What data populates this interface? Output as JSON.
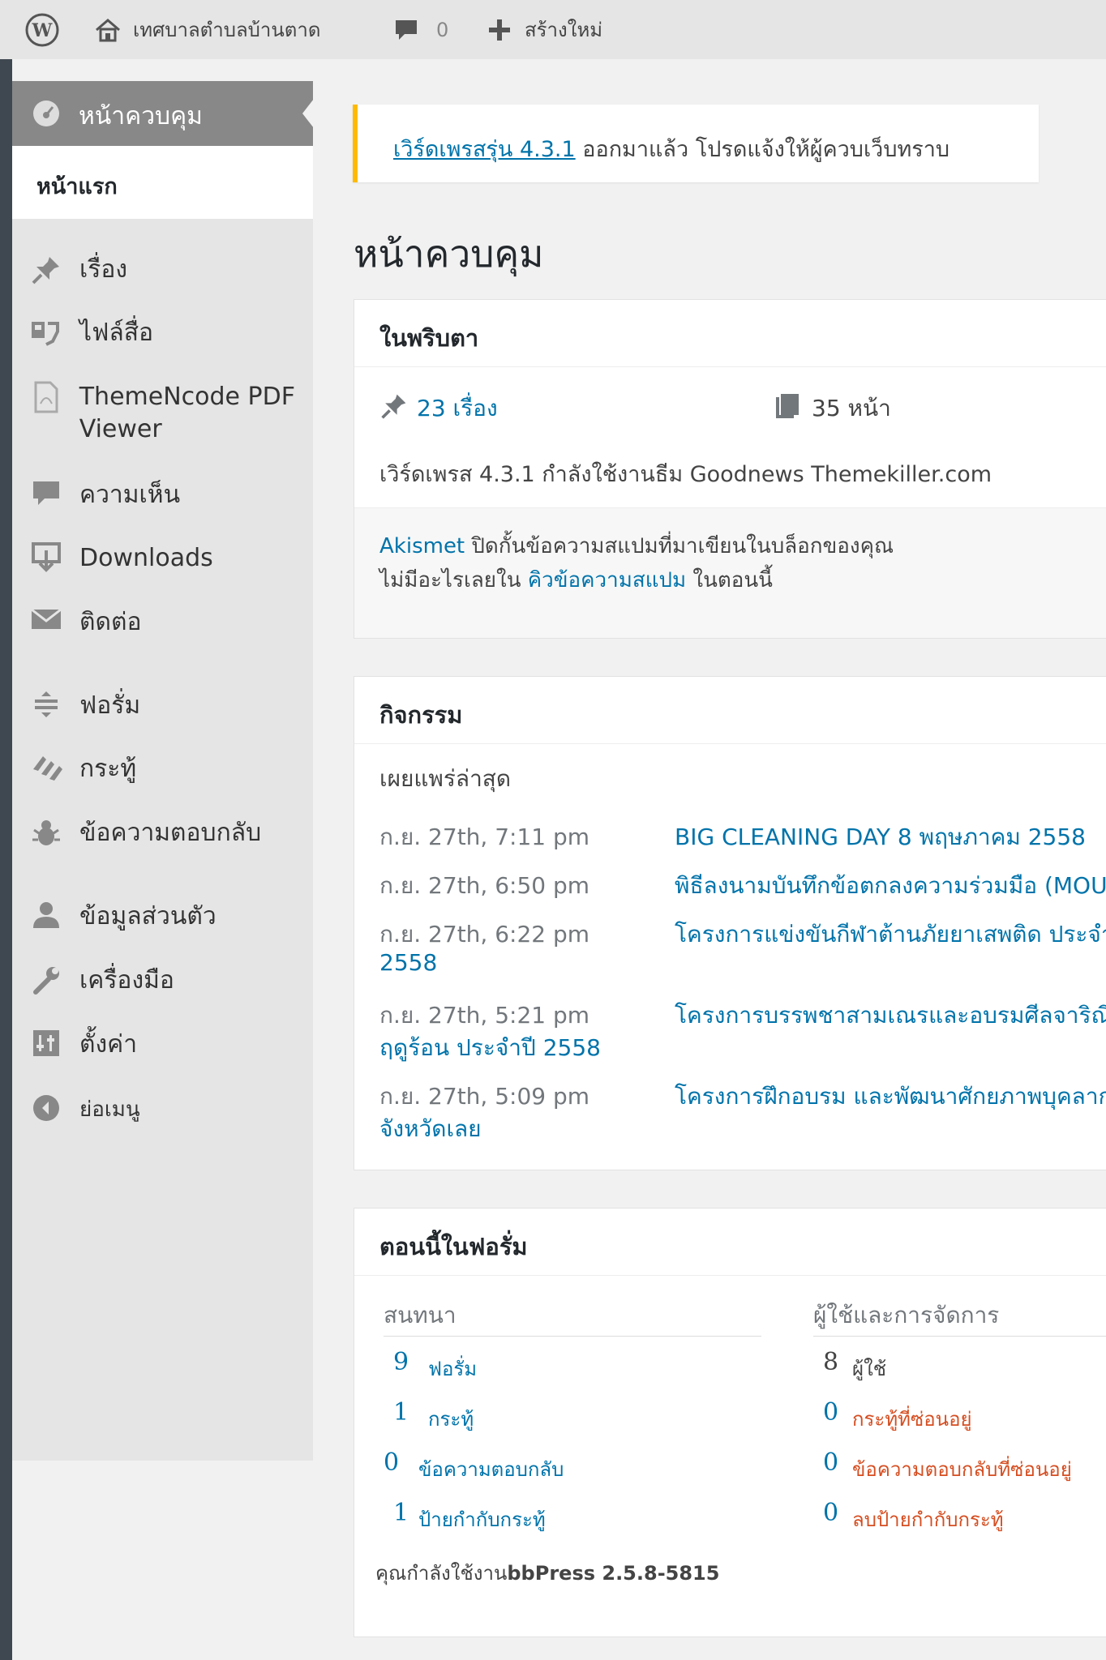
{
  "admin_bar": {
    "site_name": "เทศบาลตำบลบ้านตาด",
    "comment_count": "0",
    "new_label": "สร้างใหม่"
  },
  "sidebar": {
    "dashboard_label": "หน้าควบคุม",
    "home_label": "หน้าแรก",
    "items": [
      {
        "label": "เรื่อง",
        "icon": "pin-icon"
      },
      {
        "label": "ไฟล์สื่อ",
        "icon": "media-icon"
      },
      {
        "label": "ThemeNcode PDF Viewer",
        "icon": "pdf-icon"
      },
      {
        "label": "ความเห็น",
        "icon": "comment-icon"
      },
      {
        "label": "Downloads",
        "icon": "download-icon"
      },
      {
        "label": "ติดต่อ",
        "icon": "mail-icon"
      },
      {
        "label": "ฟอรั่ม",
        "icon": "forum-icon"
      },
      {
        "label": "กระทู้",
        "icon": "topic-icon"
      },
      {
        "label": "ข้อความตอบกลับ",
        "icon": "reply-icon"
      },
      {
        "label": "ข้อมูลส่วนตัว",
        "icon": "user-icon"
      },
      {
        "label": "เครื่องมือ",
        "icon": "wrench-icon"
      },
      {
        "label": "ตั้งค่า",
        "icon": "settings-icon"
      },
      {
        "label": "ย่อเมนู",
        "icon": "collapse-icon"
      }
    ]
  },
  "notice": {
    "link_text": "เวิร์ดเพรสรุ่น 4.3.1",
    "rest": " ออกมาแล้ว โปรดแจ้งให้ผู้ควบเว็บทราบ"
  },
  "page_title": "หน้าควบคุม",
  "glance": {
    "title": "ในพริบตา",
    "posts": "23 เรื่อง",
    "pages": "35 หน้า",
    "version_line": "เวิร์ดเพรส 4.3.1 กำลังใช้งานธีม Goodnews Themekiller.com",
    "akismet_link": "Akismet",
    "akismet_text": " ปิดกั้นข้อความสแปมที่มาเขียนในบล็อกของคุณ",
    "spam_prefix": "ไม่มีอะไรเลยใน ",
    "spam_link": "คิวข้อความสแปม",
    "spam_suffix": " ในตอนนี้"
  },
  "activity": {
    "title": "กิจกรรม",
    "subtitle": "เผยแพร่ล่าสุด",
    "rows": [
      {
        "date": "ก.ย. 27th, 7:11 pm",
        "title": "BIG CLEANING DAY 8 พฤษภาคม 2558",
        "wrap": ""
      },
      {
        "date": "ก.ย. 27th, 6:50 pm",
        "title": "พิธีลงนามบันทึกข้อตกลงความร่วมมือ (MOU",
        "wrap": ""
      },
      {
        "date": "ก.ย. 27th, 6:22 pm",
        "title": "โครงการแข่งขันกีฬาต้านภัยยาเสพติด ประจำ",
        "wrap": "2558"
      },
      {
        "date": "ก.ย. 27th, 5:21 pm",
        "title": "โครงการบรรพชาสามเณรและอบรมศีลจาริณี",
        "wrap": "ฤดูร้อน ประจำปี 2558"
      },
      {
        "date": "ก.ย. 27th, 5:09 pm",
        "title": "โครงการฝึกอบรม และพัฒนาศักยภาพบุคลาก",
        "wrap": "จังหวัดเลย"
      }
    ]
  },
  "forum": {
    "title": "ตอนนี้ในฟอรั่ม",
    "left_header": "สนทนา",
    "right_header": "ผู้ใช้และการจัดการ",
    "left": [
      {
        "count": "9",
        "label": "ฟอรั่ม"
      },
      {
        "count": "1",
        "label": "กระทู้"
      },
      {
        "count": "0",
        "label": "ข้อความตอบกลับ"
      },
      {
        "count": "1",
        "label": "ป้ายกำกับกระทู้"
      }
    ],
    "right": [
      {
        "count": "8",
        "label": "ผู้ใช้"
      },
      {
        "count": "0",
        "label": "กระทู้ที่ซ่อนอยู่"
      },
      {
        "count": "0",
        "label": "ข้อความตอบกลับที่ซ่อนอยู่"
      },
      {
        "count": "0",
        "label": "ลบป้ายกำกับกระทู้"
      }
    ],
    "footer_prefix": "คุณกำลังใช้งาน",
    "footer_bold": "bbPress 2.5.8-5815"
  }
}
